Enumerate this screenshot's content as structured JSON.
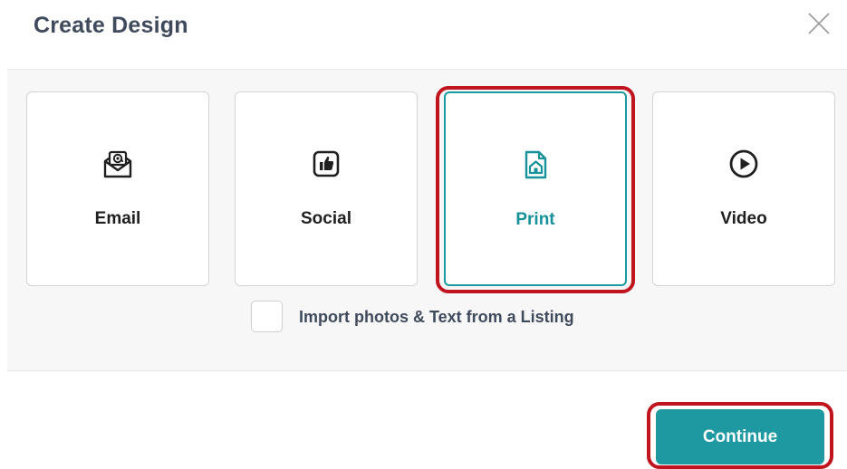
{
  "dialog": {
    "title": "Create Design",
    "close_icon": "close-icon"
  },
  "design_types": [
    {
      "label": "Email",
      "icon": "email-at-envelope-icon",
      "selected": false
    },
    {
      "label": "Social",
      "icon": "thumbs-up-icon",
      "selected": false
    },
    {
      "label": "Print",
      "icon": "print-document-house-icon",
      "selected": true
    },
    {
      "label": "Video",
      "icon": "play-circle-icon",
      "selected": false
    }
  ],
  "import_option": {
    "label": "Import photos & Text from a Listing",
    "checked": false
  },
  "footer": {
    "continue_label": "Continue"
  },
  "colors": {
    "accent": "#1e99a2",
    "highlight": "#c0141f",
    "title": "#3f4a5c"
  }
}
